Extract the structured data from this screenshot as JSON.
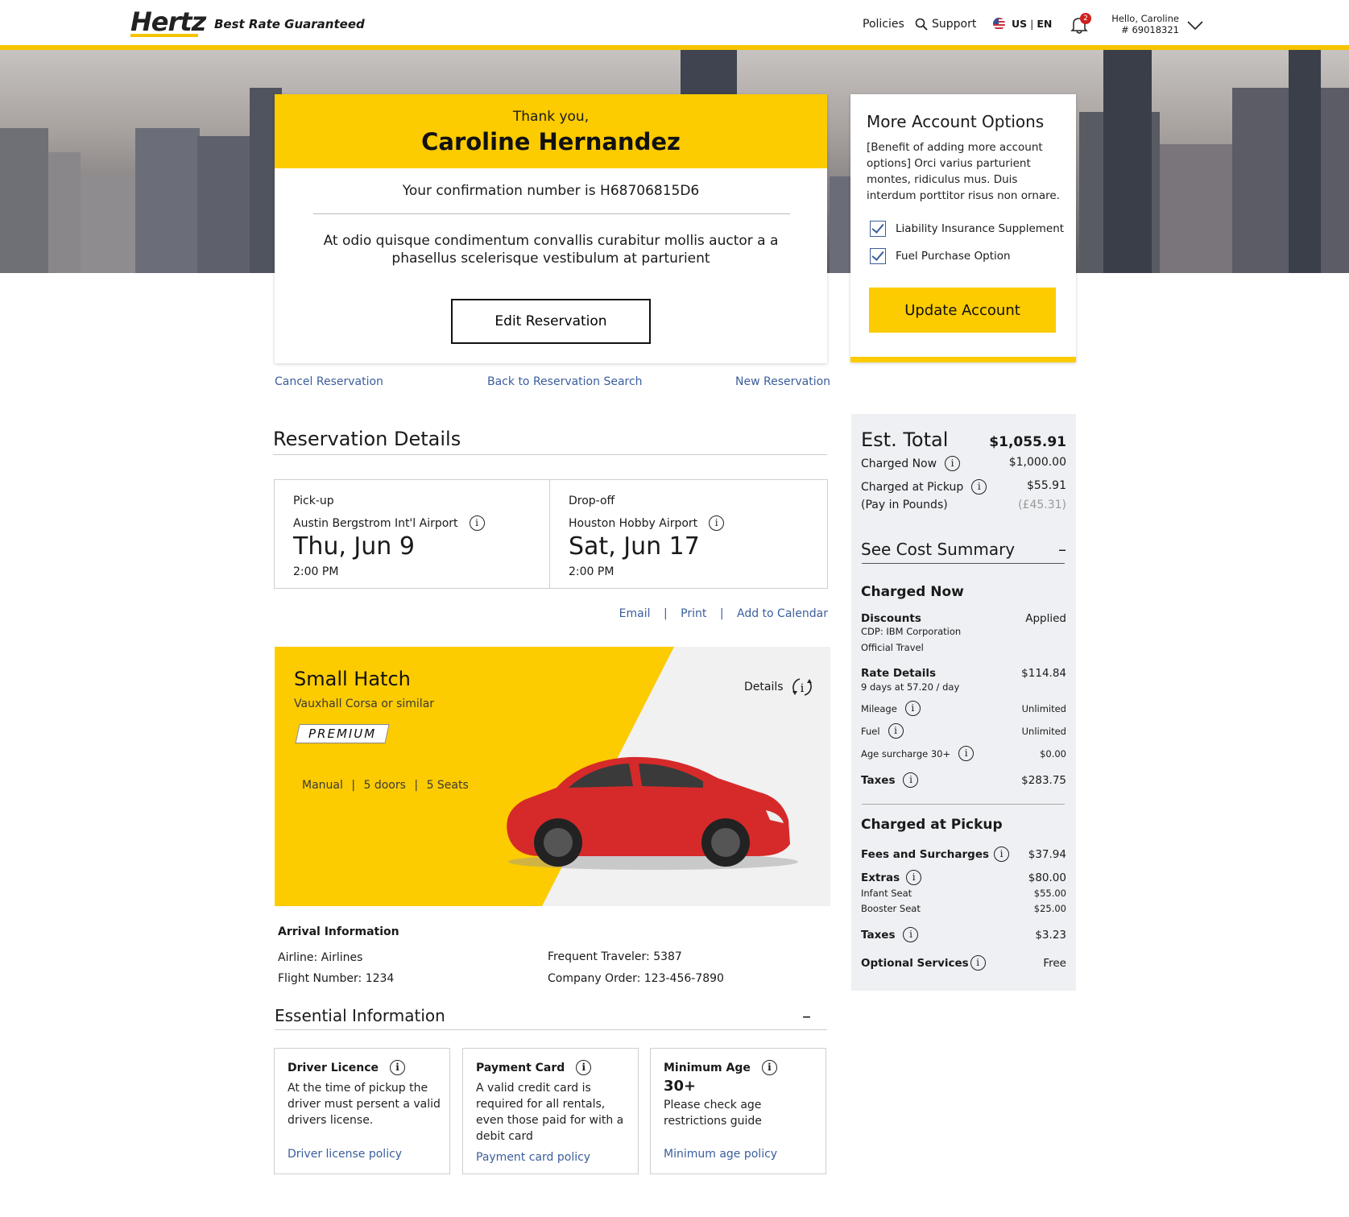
{
  "header": {
    "logo": "Hertz",
    "tagline": "Best Rate Guaranteed",
    "policies": "Policies",
    "support": "Support",
    "locale_country": "US",
    "locale_lang": "EN",
    "notification_count": "2",
    "hello": "Hello, Caroline",
    "member_no": "# 69018321"
  },
  "confirmation": {
    "thank_you": "Thank you,",
    "name": "Caroline Hernandez",
    "number_text": "Your confirmation number is H68706815D6",
    "description": "At odio quisque condimentum convallis curabitur mollis auctor a a phasellus scelerisque vestibulum at parturient",
    "edit_button": "Edit Reservation"
  },
  "links": {
    "cancel": "Cancel Reservation",
    "back": "Back to Reservation Search",
    "new": "New Reservation"
  },
  "account_options": {
    "title": "More Account Options",
    "description": "[Benefit of adding more account options] Orci varius parturient montes, ridiculus mus. Duis interdum porttitor risus non ornare.",
    "options": [
      {
        "label": "Liability Insurance Supplement",
        "checked": true
      },
      {
        "label": "Fuel Purchase Option",
        "checked": true
      }
    ],
    "update_button": "Update Account"
  },
  "reservation": {
    "title": "Reservation Details",
    "pickup": {
      "label": "Pick-up",
      "location": "Austin Bergstrom Int'l Airport",
      "date": "Thu, Jun 9",
      "time": "2:00 PM"
    },
    "dropoff": {
      "label": "Drop-off",
      "location": "Houston Hobby Airport",
      "date": "Sat, Jun 17",
      "time": "2:00 PM"
    },
    "share": {
      "email": "Email",
      "print": "Print",
      "calendar": "Add to Calendar"
    }
  },
  "car": {
    "name": "Small Hatch",
    "similar": "Vauxhall Corsa or similar",
    "badge": "PREMIUM",
    "transmission": "Manual",
    "doors": "5 doors",
    "seats": "5 Seats",
    "details": "Details",
    "color": "#d62a2a"
  },
  "arrival": {
    "title": "Arrival Information",
    "airline": "Airline:   Airlines",
    "flight": "Flight Number: 1234",
    "traveler": "Frequent Traveler: 5387",
    "company_order": "Company Order: 123-456-7890"
  },
  "essential": {
    "title": "Essential Information",
    "cards": [
      {
        "title": "Driver Licence",
        "body": "At the time of pickup the driver must persent a valid drivers license.",
        "link": "Driver license policy"
      },
      {
        "title": "Payment Card",
        "body": "A valid credit card is required for all rentals, even those paid for with a debit card",
        "link": "Payment card policy"
      },
      {
        "title": "Minimum Age",
        "value": "30+",
        "body": "Please check age restrictions guide",
        "link": "Minimum age policy"
      }
    ]
  },
  "totals": {
    "est_label": "Est. Total",
    "est_value": "$1,055.91",
    "charged_now_label": "Charged Now",
    "charged_now_value": "$1,000.00",
    "charged_pickup_label": "Charged at Pickup",
    "charged_pickup_value": "$55.91",
    "pay_pounds_label": "(Pay in Pounds)",
    "pay_pounds_value": "(£45.31)",
    "see_summary": "See Cost Summary",
    "now_section": {
      "title": "Charged Now",
      "discounts_label": "Discounts",
      "discounts_value": "Applied",
      "discount_line1": "CDP: IBM Corporation",
      "discount_line2": "Official Travel",
      "rate_label": "Rate Details",
      "rate_value": "$114.84",
      "rate_sub": "9 days at 57.20 / day",
      "mileage_label": "Mileage",
      "mileage_value": "Unlimited",
      "fuel_label": "Fuel",
      "fuel_value": "Unlimited",
      "age_label": "Age surcharge 30+",
      "age_value": "$0.00",
      "taxes_label": "Taxes",
      "taxes_value": "$283.75"
    },
    "pickup_section": {
      "title": "Charged at Pickup",
      "fees_label": "Fees and Surcharges",
      "fees_value": "$37.94",
      "extras_label": "Extras",
      "extras_value": "$80.00",
      "infant_label": "Infant Seat",
      "infant_value": "$55.00",
      "booster_label": "Booster Seat",
      "booster_value": "$25.00",
      "taxes_label": "Taxes",
      "taxes_value": "$3.23",
      "optional_label": "Optional Services",
      "optional_value": "Free"
    }
  },
  "colors": {
    "brand_yellow": "#fccb00",
    "link_blue": "#3b5e9c"
  }
}
